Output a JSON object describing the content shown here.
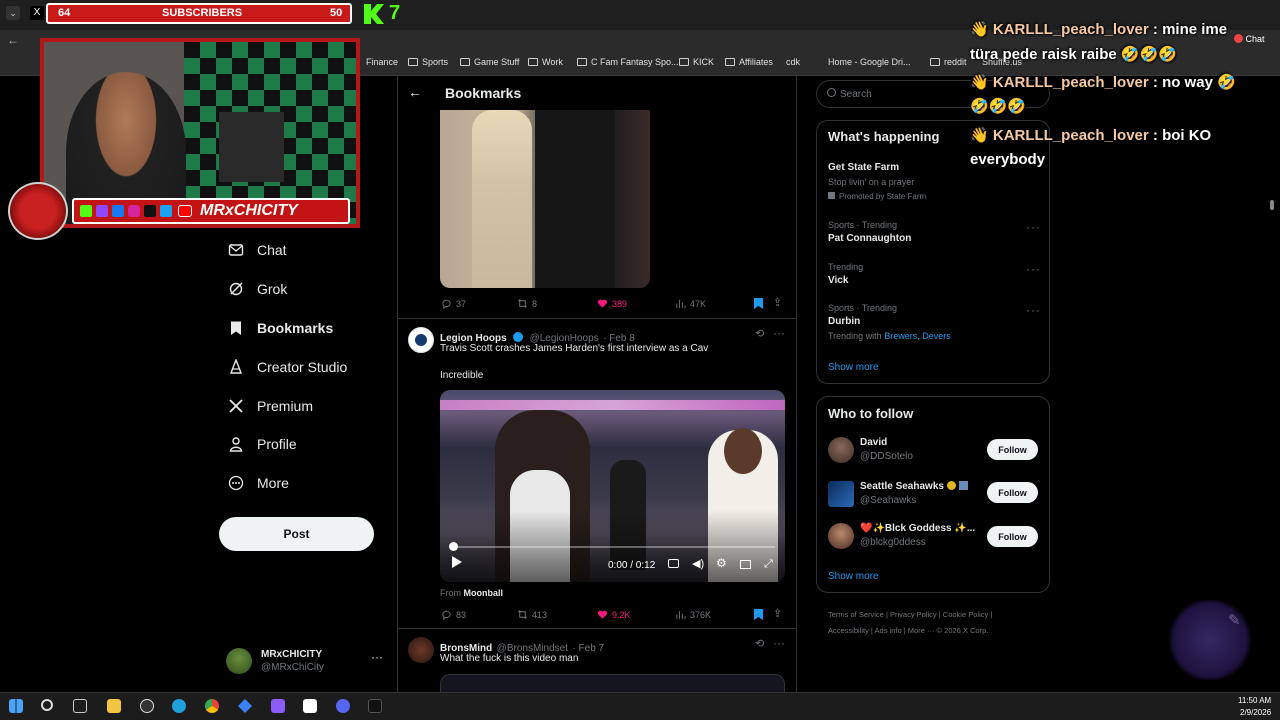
{
  "browser": {
    "bookmarks": [
      "Finance",
      "Sports",
      "Game Stuff",
      "Work",
      "C Fam Fantasy Spo...",
      "KICK",
      "Affiliates",
      "cdk",
      "Home - Google Dri...",
      "reddit",
      "Shuffle.us"
    ]
  },
  "sidebar": {
    "items": [
      {
        "label": "Chat",
        "icon": "mail-icon"
      },
      {
        "label": "Grok",
        "icon": "grok-icon"
      },
      {
        "label": "Bookmarks",
        "icon": "bookmark-icon",
        "active": true
      },
      {
        "label": "Creator Studio",
        "icon": "creator-icon"
      },
      {
        "label": "Premium",
        "icon": "x-logo-icon"
      },
      {
        "label": "Profile",
        "icon": "person-icon"
      },
      {
        "label": "More",
        "icon": "more-circle-icon"
      }
    ],
    "post_label": "Post",
    "account": {
      "name": "MRxCHICITY",
      "handle": "@MRxChiCity"
    }
  },
  "main": {
    "title": "Bookmarks",
    "tweets": [
      {
        "replies": "37",
        "reposts": "8",
        "likes": "389",
        "views": "47K"
      },
      {
        "name": "Legion Hoops",
        "handle": "@LegionHoops",
        "date": "· Feb 8",
        "text": "Travis Scott crashes James Harden's first interview as a Cav",
        "text2": "Incredible",
        "video_time": "0:00 / 0:12",
        "from_prefix": "From",
        "from_source": "Moonball",
        "replies": "83",
        "reposts": "413",
        "likes": "9.2K",
        "views": "376K"
      },
      {
        "name": "BronsMind",
        "handle": "@BronsMindset",
        "date": "· Feb 7",
        "text": "What the fuck is this video man"
      }
    ]
  },
  "right": {
    "search_placeholder": "Search",
    "happening_title": "What's happening",
    "trends": [
      {
        "meta": "",
        "title": "Get State Farm",
        "sub": "Stop livin' on a prayer",
        "promo": "Promoted by State Farm"
      },
      {
        "meta": "Sports · Trending",
        "title": "Pat Connaughton"
      },
      {
        "meta": "Trending",
        "title": "Vick"
      },
      {
        "meta": "Sports · Trending",
        "title": "Durbin",
        "with_prefix": "Trending with",
        "with_links": "Brewers, Devers"
      }
    ],
    "show_more": "Show more",
    "who_title": "Who to follow",
    "follow": [
      {
        "name": "David",
        "handle": "@DDSotelo",
        "btn": "Follow"
      },
      {
        "name": "Seattle Seahawks",
        "handle": "@Seahawks",
        "btn": "Follow"
      },
      {
        "name": "❤️✨Blck Goddess ✨...",
        "handle": "@blckg0ddess",
        "btn": "Follow"
      }
    ],
    "show_more2": "Show more",
    "footer": [
      "Terms of Service",
      "Privacy Policy",
      "Cookie Policy",
      "Accessibility",
      "Ads info",
      "More ···",
      "© 2026 X Corp."
    ]
  },
  "overlay": {
    "subs_current": "64",
    "subs_label": "SUBSCRIBERS",
    "subs_goal": "50",
    "kick_count": "7",
    "channel_name": "MRxCHICITY",
    "chat": [
      {
        "user": "KARLLL_peach_lover",
        "msg": ": mine ime",
        "cont": "türa pede raisk raibe 🤣🤣🤣"
      },
      {
        "user": "KARLLL_peach_lover",
        "msg": ": no way 🤣",
        "cont": "🤣🤣🤣"
      },
      {
        "user": "KARLLL_peach_lover",
        "msg": ": boi KO",
        "cont": "everybody"
      }
    ],
    "chat_tab": "Chat"
  },
  "taskbar": {
    "time": "11:50 AM",
    "date": "2/9/2026"
  },
  "colors": {
    "accent": "#1d9bf0",
    "like": "#f91880",
    "bg": "#000000",
    "subs_red": "#c91a1a",
    "kick_green": "#53fc18"
  }
}
